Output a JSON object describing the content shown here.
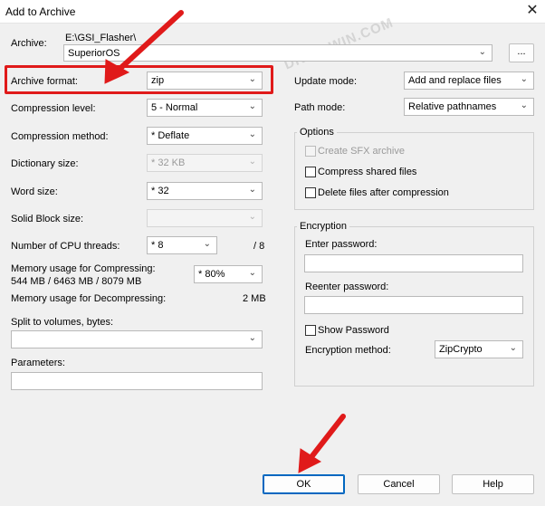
{
  "window": {
    "title": "Add to Archive",
    "close_glyph": "✕"
  },
  "watermark": "DROIDWIN.COM",
  "archive": {
    "label": "Archive:",
    "path": "E:\\GSI_Flasher\\",
    "name_value": "SuperiorOS",
    "browse_label": "..."
  },
  "left": {
    "archive_format": {
      "label": "Archive format:",
      "value": "zip"
    },
    "compression_level": {
      "label": "Compression level:",
      "value": "5 - Normal"
    },
    "compression_method": {
      "label": "Compression method:",
      "value": "* Deflate"
    },
    "dictionary_size": {
      "label": "Dictionary size:",
      "value": "* 32 KB"
    },
    "word_size": {
      "label": "Word size:",
      "value": "* 32"
    },
    "solid_block_size": {
      "label": "Solid Block size:",
      "value": ""
    },
    "cpu_threads": {
      "label": "Number of CPU threads:",
      "value": "* 8",
      "max": "/ 8"
    },
    "mem_compress": {
      "label": "Memory usage for Compressing:",
      "detail": "544 MB / 6463 MB / 8079 MB",
      "value": "* 80%"
    },
    "mem_decompress": {
      "label": "Memory usage for Decompressing:",
      "value": "2 MB"
    },
    "split": {
      "label": "Split to volumes, bytes:",
      "value": ""
    },
    "parameters": {
      "label": "Parameters:",
      "value": ""
    }
  },
  "right": {
    "update_mode": {
      "label": "Update mode:",
      "value": "Add and replace files"
    },
    "path_mode": {
      "label": "Path mode:",
      "value": "Relative pathnames"
    },
    "options": {
      "title": "Options",
      "sfx": "Create SFX archive",
      "shared": "Compress shared files",
      "delete_after": "Delete files after compression"
    },
    "encryption": {
      "title": "Encryption",
      "enter_password": "Enter password:",
      "reenter_password": "Reenter password:",
      "show_password": "Show Password",
      "method_label": "Encryption method:",
      "method_value": "ZipCrypto"
    }
  },
  "buttons": {
    "ok": "OK",
    "cancel": "Cancel",
    "help": "Help"
  },
  "colors": {
    "annotation_red": "#e01a1a",
    "accent_blue": "#0067c0"
  }
}
